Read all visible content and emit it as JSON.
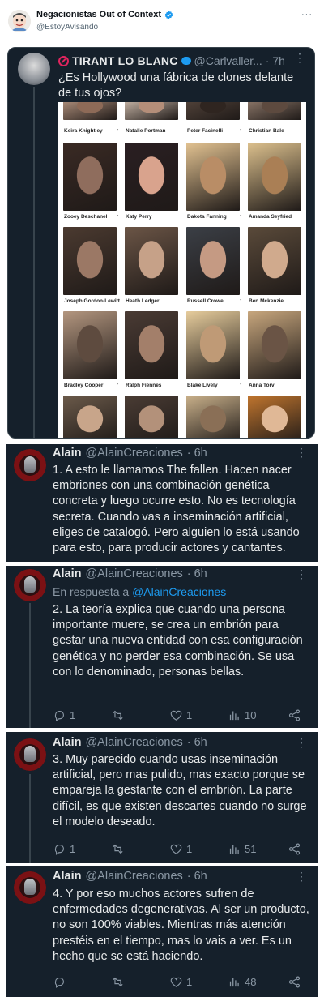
{
  "outer": {
    "name": "Negacionistas Out of Context",
    "handle": "@EstoyAvisando",
    "more": "···",
    "colors": {
      "verified": "#1d9bf0"
    }
  },
  "quoted": {
    "name": "TIRANT LO BLANC",
    "handle": "@Carlvaller...",
    "time": "· 7h",
    "more": "⋮",
    "text": "¿Es Hollywood una fábrica de clones delante de tus ojos?",
    "collage": [
      [
        "Keira Knightley",
        "Natalie Portman",
        "Peter Facinelli",
        "Christian Bale"
      ],
      [
        "Zooey Deschanel",
        "Katy Perry",
        "Dakota Fanning",
        "Amanda Seyfried"
      ],
      [
        "Joseph Gordon-Lewitt",
        "Heath Ledger",
        "Russell Crowe",
        "Ben Mckenzie"
      ],
      [
        "Bradley Cooper",
        "Ralph Fiennes",
        "Blake Lively",
        "Anna Torv"
      ]
    ],
    "collage_dash": "-"
  },
  "tweets": [
    {
      "name": "Alain",
      "handle": "@AlainCreaciones",
      "time": "· 6h",
      "more": "⋮",
      "text": "1. A esto le llamamos The fallen. Hacen nacer embriones con una combinación genética concreta y luego ocurre esto. No es tecnología secreta. Cuando vas a inseminación artificial, eliges de catalogó. Pero alguien lo está usando para esto, para producir actores y cantantes."
    },
    {
      "name": "Alain",
      "handle": "@AlainCreaciones",
      "time": "· 6h",
      "more": "⋮",
      "reply_to_prefix": "En respuesta a",
      "reply_to_handle": "@AlainCreaciones",
      "text": "2. La teoría explica que cuando una persona importante muere, se crea un embrión para gestar una nueva entidad con esa configuración genética y no perder esa combinación. Se usa con lo denominado, personas bellas.",
      "replies": "1",
      "reposts": "",
      "likes": "1",
      "views": "10"
    },
    {
      "name": "Alain",
      "handle": "@AlainCreaciones",
      "time": "· 6h",
      "more": "⋮",
      "text": "3. Muy parecido cuando usas inseminación artificial, pero mas pulido, mas exacto porque se empareja la gestante con el embrión. La parte difícil, es que existen descartes cuando no surge el modelo deseado.",
      "replies": "1",
      "reposts": "",
      "likes": "1",
      "views": "51"
    },
    {
      "name": "Alain",
      "handle": "@AlainCreaciones",
      "time": "· 6h",
      "more": "⋮",
      "text": "4. Y por eso muchos actores sufren de enfermedades degenerativas. Al ser un producto, no son 100% viables. Mientras más atención prestéis en el tiempo, mas lo vais a ver. Es un hecho que se está haciendo.",
      "replies": "",
      "reposts": "",
      "likes": "1",
      "views": "48"
    }
  ]
}
